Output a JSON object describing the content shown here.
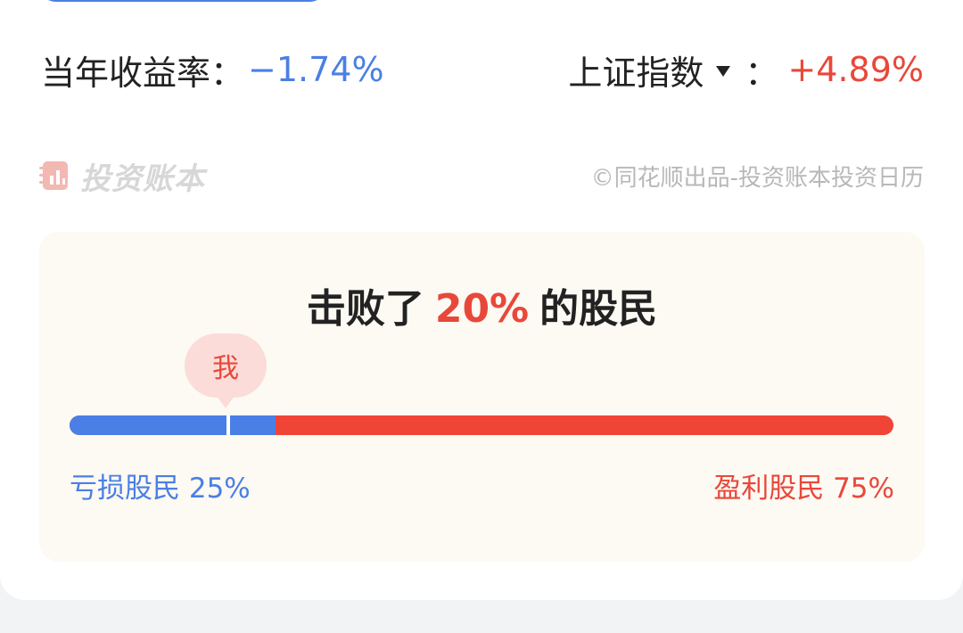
{
  "returns": {
    "annual_label": "当年收益率：",
    "annual_value": "−1.74%",
    "index_label": "上证指数",
    "index_colon": "：",
    "index_value": "+4.89%"
  },
  "brand": {
    "name": "投资账本",
    "copyright": "©同花顺出品-投资账本投资日历"
  },
  "ranking": {
    "headline_prefix": "击败了",
    "beat_percent": "20%",
    "headline_suffix": "的股民",
    "me_label": "我",
    "loss_label": "亏损股民 25%",
    "gain_label": "盈利股民 75%",
    "loss_share": 0.25,
    "me_position": 0.19
  },
  "colors": {
    "loss": "#4a7fe6",
    "gain": "#e8483a",
    "box_bg": "#fdf9f3"
  }
}
